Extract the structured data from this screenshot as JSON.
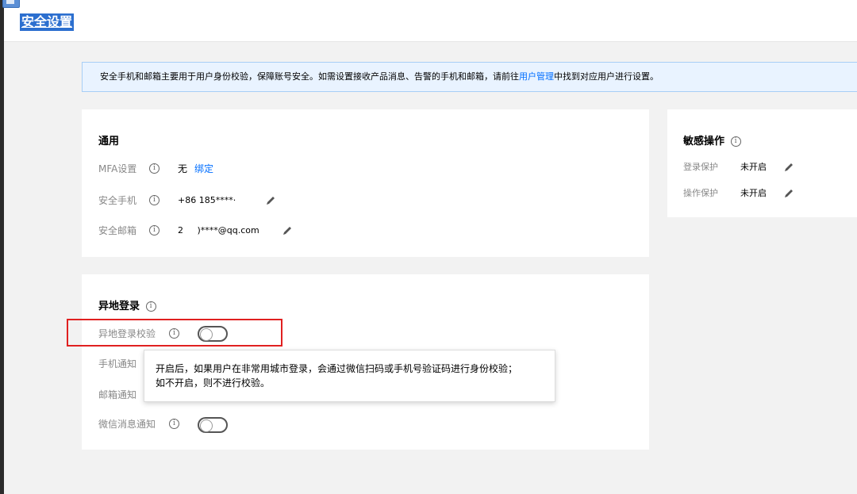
{
  "header": {
    "title": "安全设置"
  },
  "notice": {
    "text_before": "安全手机和邮箱主要用于用户身份校验，保障账号安全。如需设置接收产品消息、告警的手机和邮箱，请前往",
    "link": "用户管理",
    "text_after": "中找到对应用户进行设置。"
  },
  "general": {
    "title": "通用",
    "mfa_label": "MFA设置",
    "mfa_value": "无",
    "mfa_bind": "绑定",
    "phone_label": "安全手机",
    "phone_value": "+86 185****·",
    "email_label": "安全邮箱",
    "email_value": "2     )****@qq.com"
  },
  "sensitive": {
    "title": "敏感操作",
    "login_label": "登录保护",
    "login_value": "未开启",
    "op_label": "操作保护",
    "op_value": "未开启"
  },
  "remote": {
    "title": "异地登录",
    "check_label": "异地登录校验",
    "phone_label": "手机通知",
    "email_label": "邮箱通知",
    "wechat_label": "微信消息通知"
  },
  "tooltip": {
    "line1": "开启后，如果用户在非常用城市登录，会通过微信扫码或手机号验证码进行身份校验；",
    "line2": "如不开启，则不进行校验。"
  },
  "icons": {
    "info": "info-icon",
    "edit": "pencil-icon"
  },
  "colors": {
    "link": "#006eff",
    "highlight": "#e02020",
    "title_bg": "#2c6fcf"
  }
}
